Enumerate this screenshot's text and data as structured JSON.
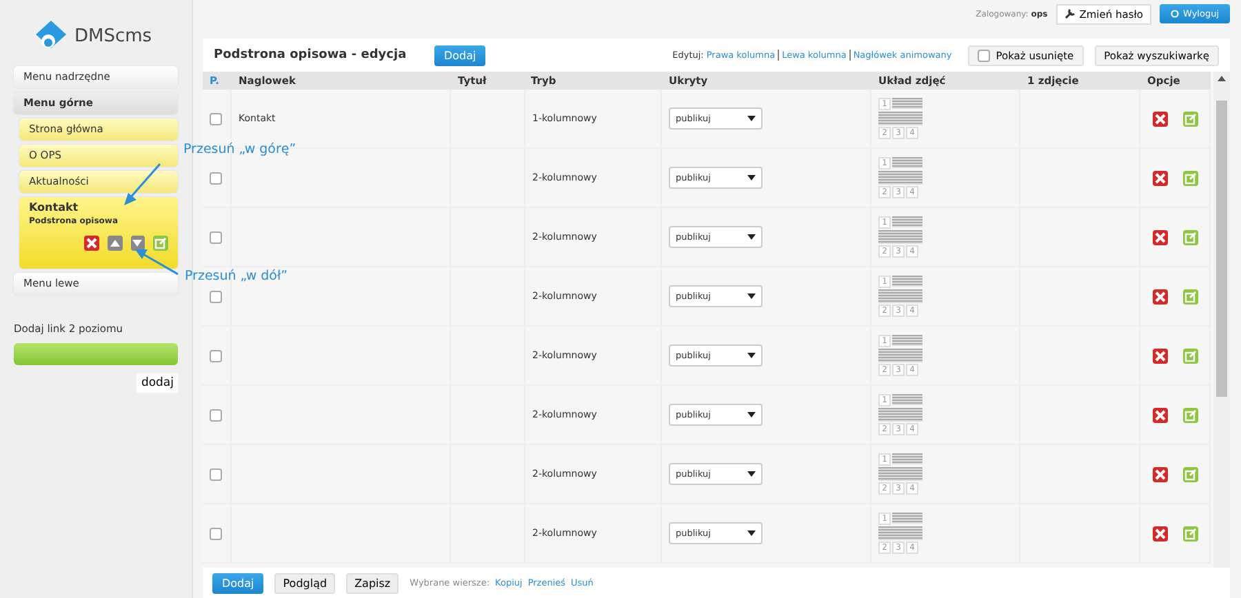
{
  "logo": {
    "text": "DMScms"
  },
  "topbar": {
    "logged_label": "Zalogowany:",
    "user": "ops",
    "change_password": "Zmień hasło",
    "logout": "Wyloguj"
  },
  "sidebar": {
    "items": [
      {
        "kind": "plain",
        "label": "Menu nadrzędne"
      },
      {
        "kind": "section",
        "label": "Menu górne"
      },
      {
        "kind": "yellow",
        "label": "Strona główna"
      },
      {
        "kind": "yellow",
        "label": "O OPS"
      },
      {
        "kind": "yellow",
        "label": "Aktualności"
      },
      {
        "kind": "expanded",
        "label": "Kontakt",
        "subtitle": "Podstrona opisowa"
      },
      {
        "kind": "plain",
        "label": "Menu lewe"
      }
    ],
    "add_label": "Dodaj link 2 poziomu",
    "add_button": "dodaj"
  },
  "annotations": [
    {
      "text": "Przesuń „w górę”"
    },
    {
      "text": "Przesuń „w dół”"
    }
  ],
  "panel": {
    "title": "Podstrona opisowa - edycja",
    "add_button": "Dodaj",
    "edit_label": "Edytuj:",
    "edit_links": [
      "Prawa kolumna",
      "Lewa kolumna",
      "Nagłówek animowany"
    ],
    "show_deleted": {
      "label": "Pokaż usunięte",
      "checked": false
    },
    "show_search": "Pokaż wyszukiwarkę"
  },
  "table": {
    "columns": [
      "P.",
      "Naglowek",
      "Tytuł",
      "Tryb",
      "Ukryty",
      "Układ zdjęć",
      "1 zdjęcie",
      "Opcje"
    ],
    "rows": [
      {
        "selected": false,
        "heading": "Kontakt",
        "mode": "1-kolumnowy",
        "hidden": "publikuj",
        "layout_labels": [
          "1",
          "2",
          "3",
          "4"
        ]
      },
      {
        "selected": false,
        "mode": "2-kolumnowy",
        "hidden": "publikuj",
        "layout_labels": [
          "1",
          "2",
          "3",
          "4"
        ]
      },
      {
        "selected": false,
        "mode": "2-kolumnowy",
        "hidden": "publikuj",
        "layout_labels": [
          "1",
          "2",
          "3",
          "4"
        ]
      },
      {
        "selected": false,
        "mode": "2-kolumnowy",
        "hidden": "publikuj",
        "layout_labels": [
          "1",
          "2",
          "3",
          "4"
        ]
      },
      {
        "selected": false,
        "mode": "2-kolumnowy",
        "hidden": "publikuj",
        "layout_labels": [
          "1",
          "2",
          "3",
          "4"
        ]
      },
      {
        "selected": false,
        "mode": "2-kolumnowy",
        "hidden": "publikuj",
        "layout_labels": [
          "1",
          "2",
          "3",
          "4"
        ]
      },
      {
        "selected": false,
        "mode": "2-kolumnowy",
        "hidden": "publikuj",
        "layout_labels": [
          "1",
          "2",
          "3",
          "4"
        ]
      },
      {
        "selected": false,
        "mode": "2-kolumnowy",
        "hidden": "publikuj",
        "layout_labels": [
          "1",
          "2",
          "3",
          "4"
        ]
      }
    ]
  },
  "footer": {
    "buttons": [
      {
        "kind": "primary",
        "label": "Dodaj"
      },
      {
        "kind": "plain",
        "label": "Podgląd"
      },
      {
        "kind": "plain",
        "label": "Zapisz"
      }
    ],
    "selected_label": "Wybrane wiersze:",
    "links": [
      "Kopiuj",
      "Przenieś",
      "Usuń"
    ]
  }
}
